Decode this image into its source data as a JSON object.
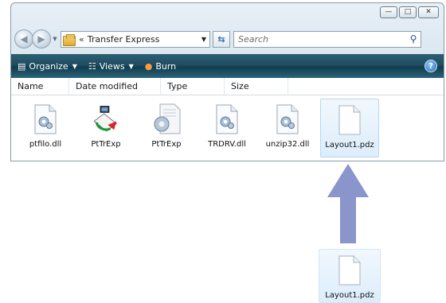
{
  "window": {
    "controls": {
      "minimize": "—",
      "maximize": "□",
      "close": "✕"
    },
    "address": {
      "prefix": "«",
      "path": "Transfer Express"
    },
    "search": {
      "placeholder": "Search"
    }
  },
  "toolbar": {
    "organize": "Organize",
    "views": "Views",
    "burn": "Burn",
    "help": "?"
  },
  "columns": [
    "Name",
    "Date modified",
    "Type",
    "Size"
  ],
  "files": [
    {
      "name": "ptfilo.dll",
      "icon": "dll-gear-icon"
    },
    {
      "name": "PtTrExp",
      "icon": "transfer-express-app-icon"
    },
    {
      "name": "PtTrExp",
      "icon": "gear-file-icon"
    },
    {
      "name": "TRDRV.dll",
      "icon": "dll-gear-icon"
    },
    {
      "name": "unzip32.dll",
      "icon": "dll-gear-icon"
    },
    {
      "name": "Layout1.pdz",
      "icon": "blank-document-icon",
      "selected": true
    }
  ],
  "dragged_file": {
    "name": "Layout1.pdz",
    "icon": "blank-document-icon"
  },
  "colors": {
    "arrow": "#8a95cc",
    "toolbar": "#1f4d61",
    "selection": "#dcedfb"
  }
}
